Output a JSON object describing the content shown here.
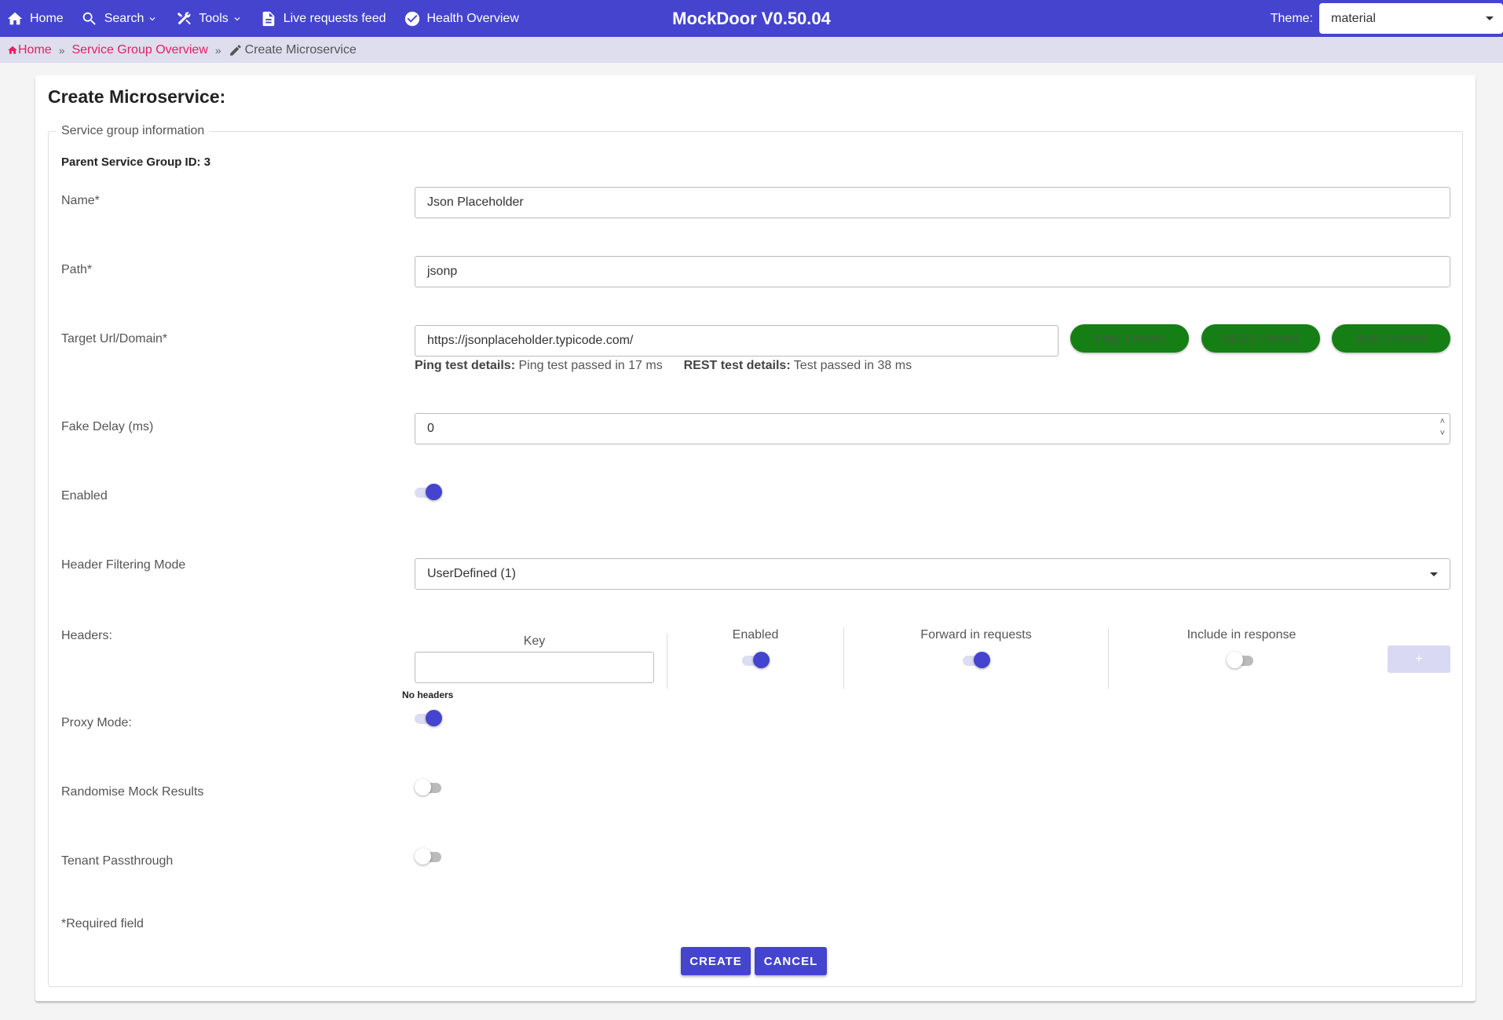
{
  "topbar": {
    "nav": [
      {
        "label": "Home",
        "icon": "home-icon"
      },
      {
        "label": "Search",
        "icon": "search-icon"
      },
      {
        "label": "Tools",
        "icon": "tools-icon"
      },
      {
        "label": "Live requests feed",
        "icon": "document-icon"
      },
      {
        "label": "Health Overview",
        "icon": "check-circle-icon"
      }
    ],
    "title": "MockDoor V0.50.04",
    "theme_label": "Theme:",
    "theme_value": "material"
  },
  "breadcrumb": {
    "home": "Home",
    "group": "Service Group Overview",
    "current": "Create Microservice",
    "sep": "»"
  },
  "page": {
    "title": "Create Microservice:",
    "legend": "Service group information",
    "parent_id": "Parent Service Group ID: 3",
    "required_note": "*Required field"
  },
  "form": {
    "name": {
      "label": "Name*",
      "value": "Json Placeholder"
    },
    "path": {
      "label": "Path*",
      "value": "jsonp"
    },
    "target": {
      "label": "Target Url/Domain*",
      "value": "https://jsonplaceholder.typicode.com/",
      "ping_badge": "Ping: Passed",
      "rest_badge": "REST: Passed",
      "both_badge": "Both: Passed",
      "ping_details_label": "Ping test details:",
      "ping_details": "Ping test passed in 17 ms",
      "rest_details_label": "REST test details:",
      "rest_details": "Test passed in 38 ms",
      "badge_color": "#157f15"
    },
    "fake_delay": {
      "label": "Fake Delay (ms)",
      "value": "0"
    },
    "enabled": {
      "label": "Enabled",
      "on": true
    },
    "header_filtering": {
      "label": "Header Filtering Mode",
      "value": "UserDefined (1)"
    },
    "headers": {
      "label": "Headers:",
      "key_header": "Key",
      "key_value": "",
      "enabled_header": "Enabled",
      "forward_header": "Forward in requests",
      "include_header": "Include in response",
      "add_label": "+",
      "empty_note": "No headers",
      "enabled_on": true,
      "forward_on": true,
      "include_on": false
    },
    "proxy_mode": {
      "label": "Proxy Mode:",
      "on": true
    },
    "randomise": {
      "label": "Randomise Mock Results",
      "on": false
    },
    "tenant": {
      "label": "Tenant Passthrough",
      "on": false
    }
  },
  "actions": {
    "create": "CREATE",
    "cancel": "CANCEL"
  },
  "colors": {
    "primary": "#4444cf",
    "accent": "#e91e63"
  }
}
